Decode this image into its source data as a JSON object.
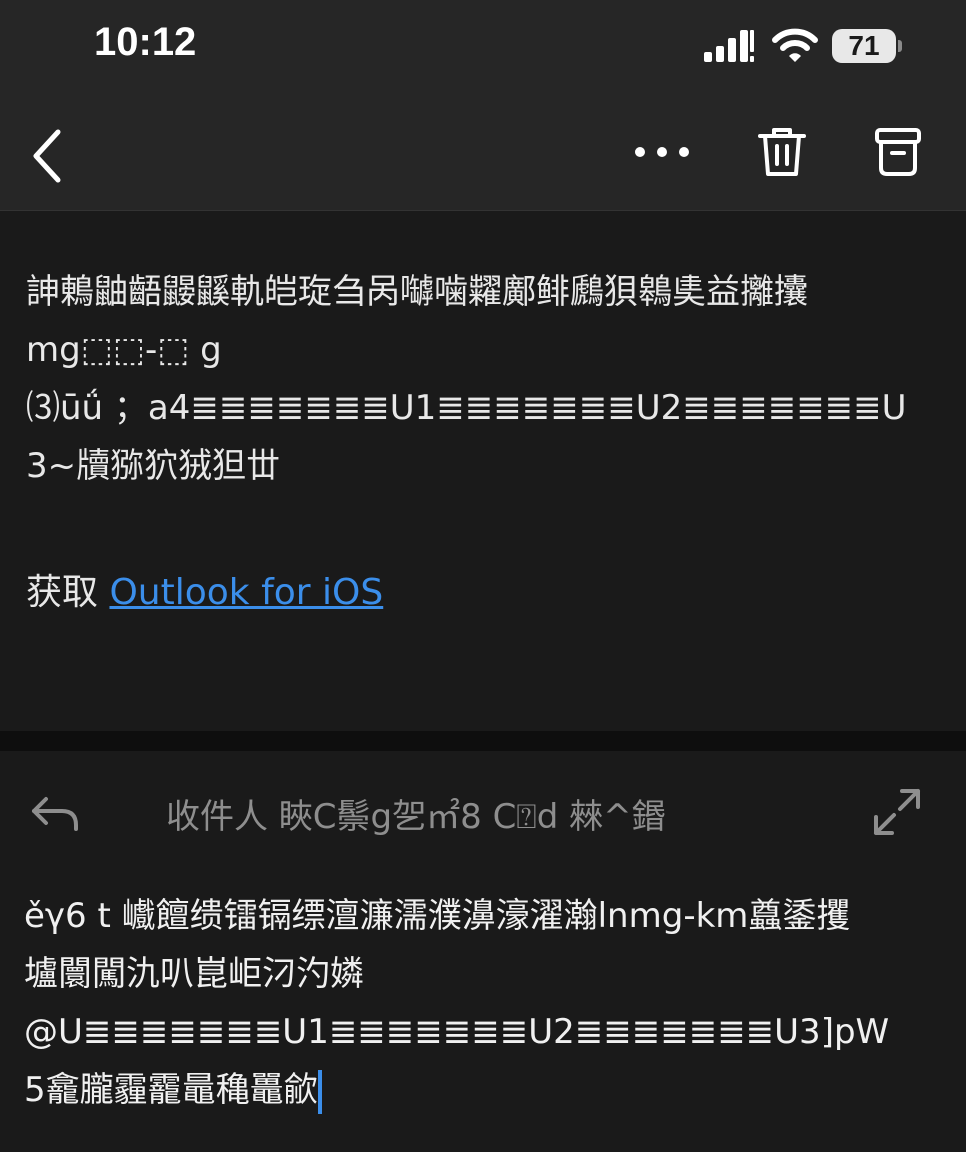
{
  "status_bar": {
    "time": "10:12",
    "battery": "71",
    "icons": [
      "cellular-signal-icon",
      "wifi-icon",
      "battery-icon"
    ]
  },
  "toolbar": {
    "icons": [
      "back-chevron-icon",
      "more-dots-icon",
      "trash-icon",
      "archive-icon"
    ]
  },
  "message": {
    "body": "訷鶇鼬齬鼹鼷軌皑琁刍呙嚹噛糶鄺鲱鷉狽鷎奊益攡攮\nmg⬚⬚-⬚ g\n⑶ūǘ ；a4≣≣≣≣≣≣≣U1≣≣≣≣≣≣≣U2≣≣≣≣≣≣≣U\n3~牘猕狖狨狚丗",
    "get_prefix": "获取",
    "get_link": "Outlook for iOS"
  },
  "compose": {
    "recipients": "收件人 䀹C鬃g乫㎡8 C⍰d 㯤^鍲",
    "body": "ěγ6 t 巇饘缋镭镉缥澶濂濡濮濞濠濯瀚lnmg-km蠤鋈攫\n壚闤闖氿叭崑岠汈汋嫾\n@U≣≣≣≣≣≣≣U1≣≣≣≣≣≣≣U2≣≣≣≣≣≣≣U3]pW\n5龕朧霾靇鼂穐鼉歈",
    "accent": "#3b8eea"
  }
}
